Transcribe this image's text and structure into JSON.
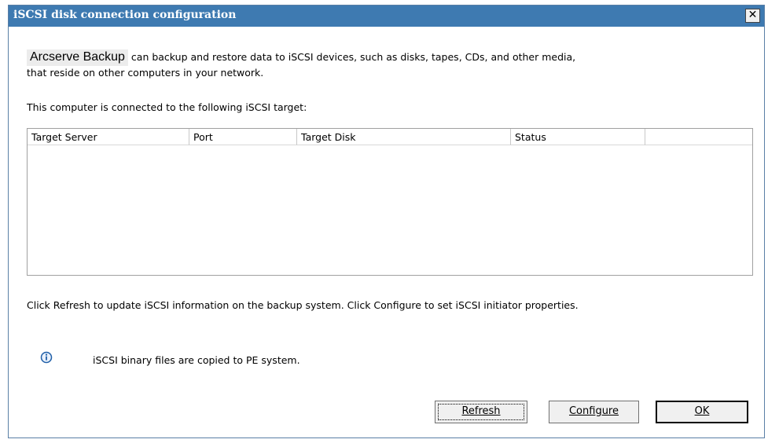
{
  "window": {
    "title": "iSCSI disk connection configuration",
    "close_glyph": "✕"
  },
  "intro": {
    "product_name": "Arcserve Backup",
    "line1_rest": " can backup and restore data to iSCSI devices, such as disks, tapes, CDs, and other media,",
    "line2": "that reside on other computers in your network."
  },
  "connected_label": "This computer is connected to the following iSCSI target:",
  "table": {
    "columns": [
      "Target Server",
      "Port",
      "Target Disk",
      "Status",
      ""
    ],
    "rows": []
  },
  "refresh_hint": "Click Refresh to update iSCSI information on the backup system. Click Configure to set iSCSI initiator properties.",
  "info": {
    "icon": "info-icon",
    "text": "iSCSI binary files are copied to PE system."
  },
  "buttons": {
    "refresh": "Refresh",
    "configure": "Configure",
    "ok": "OK"
  },
  "colors": {
    "titlebar": "#3e7ab1",
    "accent": "#1f5fa8"
  }
}
